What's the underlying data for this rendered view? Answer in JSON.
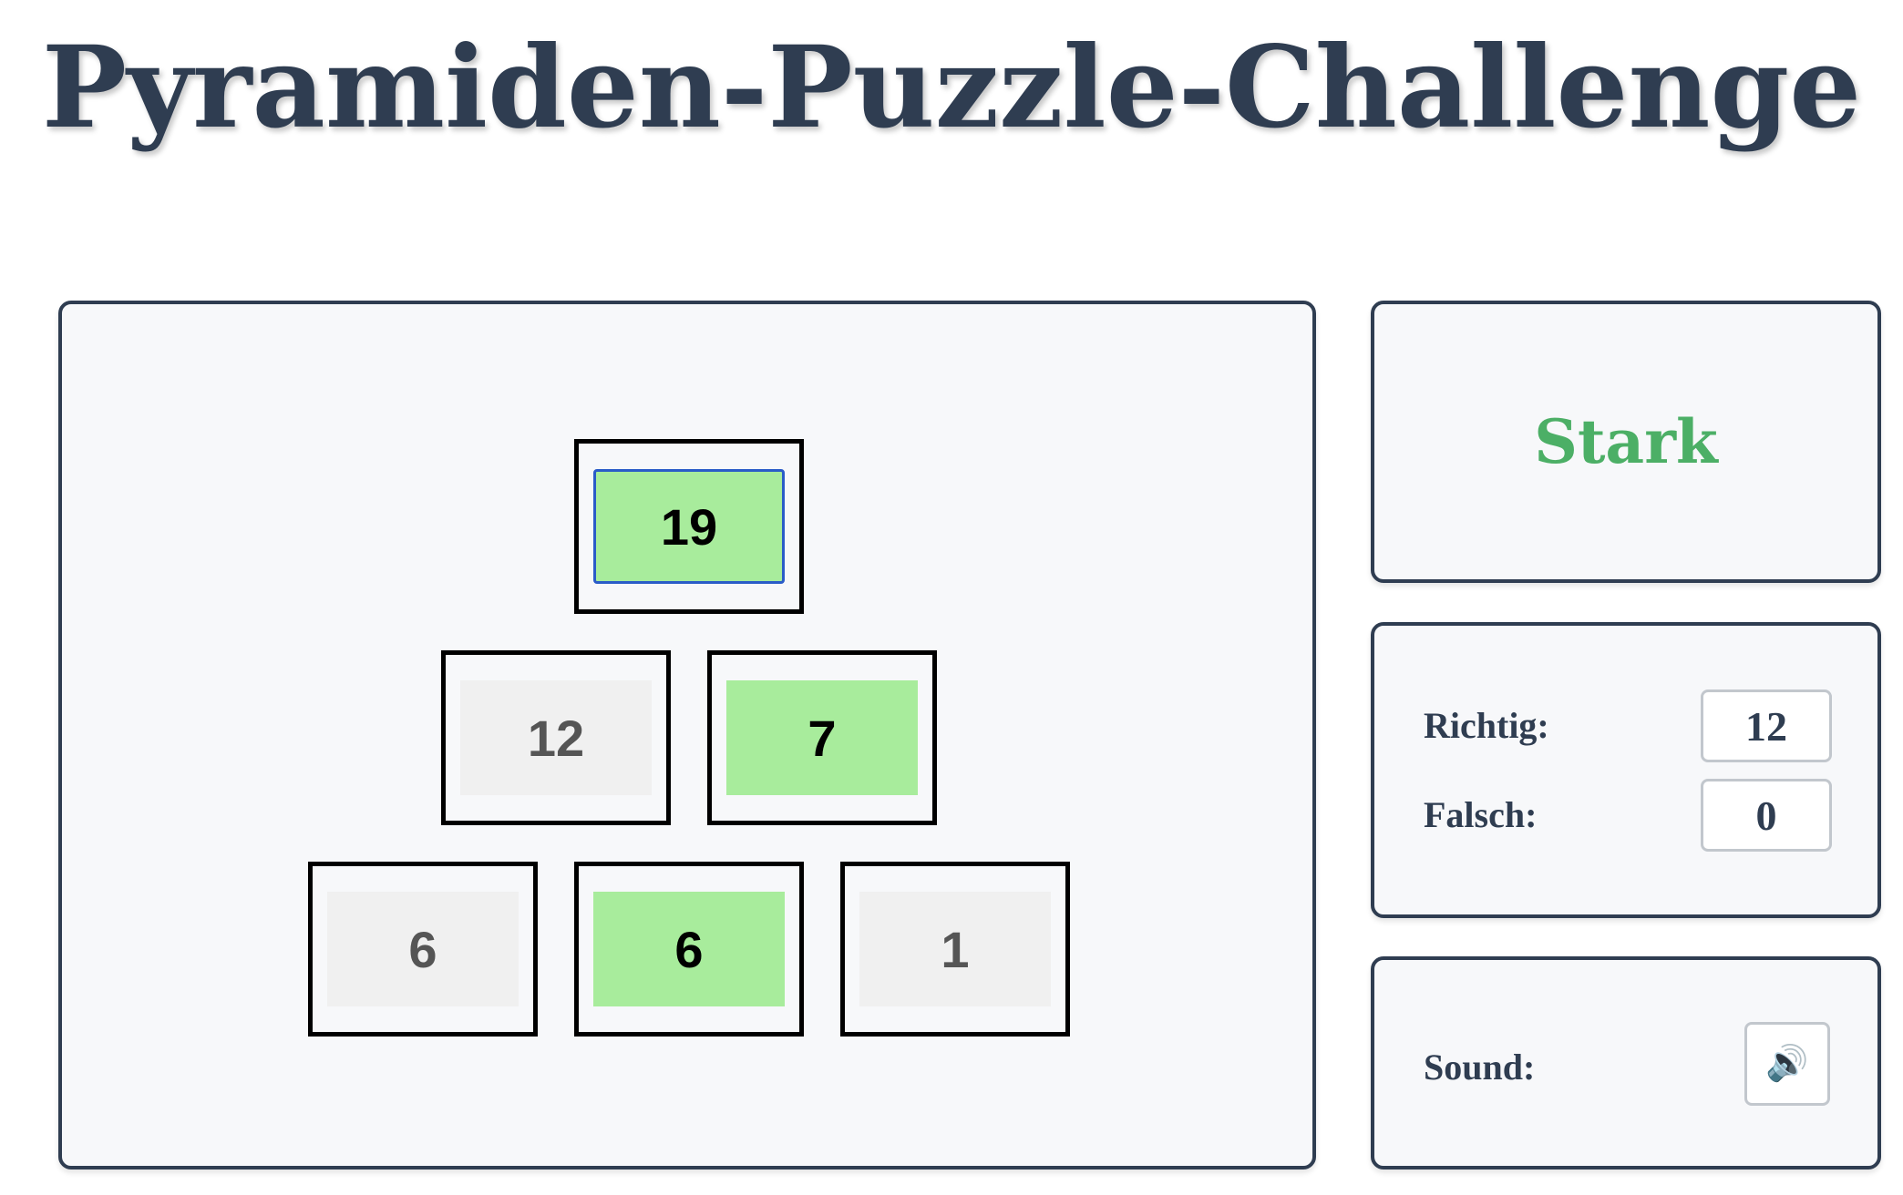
{
  "page": {
    "title": "Pyramiden-Puzzle-Challenge"
  },
  "pyramid": {
    "top": {
      "value": "19",
      "state": "solved",
      "focused": true
    },
    "middle": [
      {
        "value": "12",
        "state": "given"
      },
      {
        "value": "7",
        "state": "solved"
      }
    ],
    "bottom": [
      {
        "value": "6",
        "state": "given"
      },
      {
        "value": "6",
        "state": "solved"
      },
      {
        "value": "1",
        "state": "given"
      }
    ]
  },
  "feedback": {
    "text": "Stark",
    "color": "#4caf66"
  },
  "score": {
    "correct_label": "Richtig:",
    "correct_value": "12",
    "wrong_label": "Falsch:",
    "wrong_value": "0"
  },
  "sound": {
    "label": "Sound:",
    "icon": "speaker-icon",
    "glyph": "🔊"
  },
  "colors": {
    "title": "#2f3d51",
    "panel_border": "#2f3d51",
    "solved_cell": "#a8ec9c",
    "given_cell": "#f0f0f0",
    "focus_ring": "#2a5cc8"
  }
}
